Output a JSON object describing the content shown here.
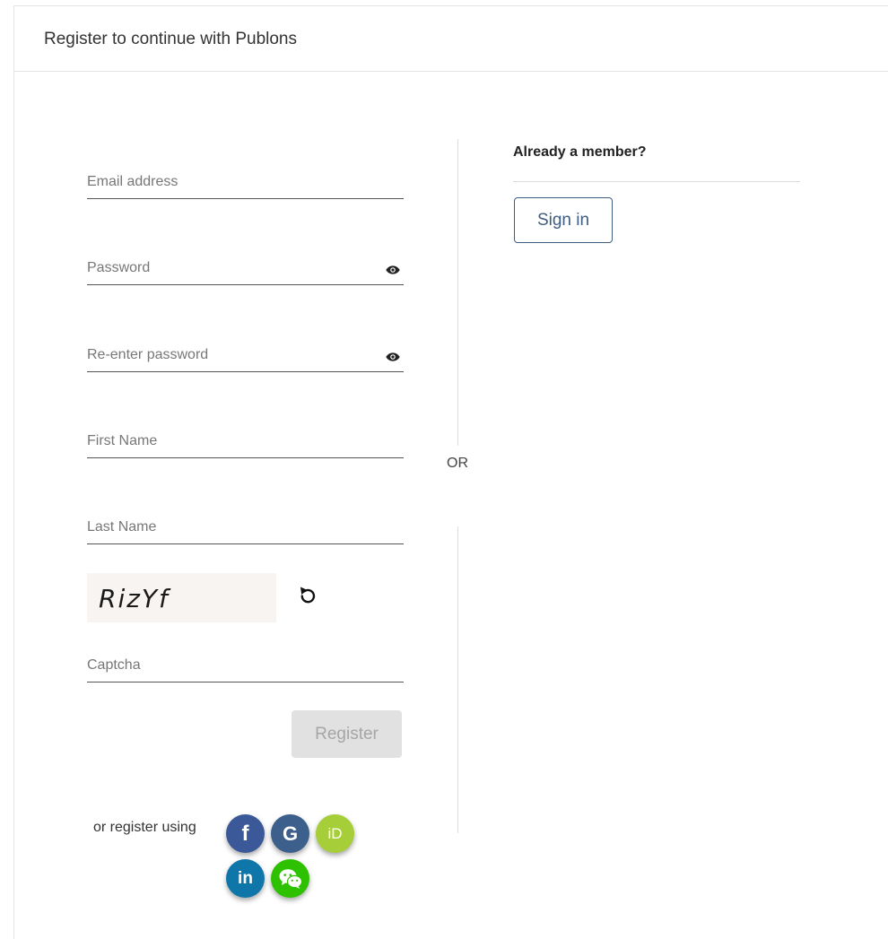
{
  "header": {
    "title": "Register to continue with Publons"
  },
  "form": {
    "email": {
      "placeholder": "Email address",
      "value": ""
    },
    "password": {
      "placeholder": "Password",
      "value": ""
    },
    "reenter_password": {
      "placeholder": "Re-enter password",
      "value": ""
    },
    "first_name": {
      "placeholder": "First Name",
      "value": ""
    },
    "last_name": {
      "placeholder": "Last Name",
      "value": ""
    },
    "captcha": {
      "image_text": "RizYf",
      "placeholder": "Captcha",
      "value": ""
    },
    "register_label": "Register",
    "or_register_using": "or register using"
  },
  "social": [
    {
      "name": "facebook",
      "glyph": "f",
      "color": "#3b5998"
    },
    {
      "name": "google",
      "glyph": "G",
      "color": "#3d5f8c"
    },
    {
      "name": "orcid",
      "glyph": "iD",
      "color": "#a6ce39"
    },
    {
      "name": "linkedin",
      "glyph": "in",
      "color": "#0e76a8"
    },
    {
      "name": "wechat",
      "glyph": "wechat-icon",
      "color": "#2dc100"
    }
  ],
  "divider": {
    "or": "OR"
  },
  "member": {
    "title": "Already a member?",
    "signin_label": "Sign in"
  },
  "colors": {
    "accent": "#3f5d80",
    "disabled_bg": "#e1e1e1",
    "disabled_text": "#a5a5a5"
  }
}
